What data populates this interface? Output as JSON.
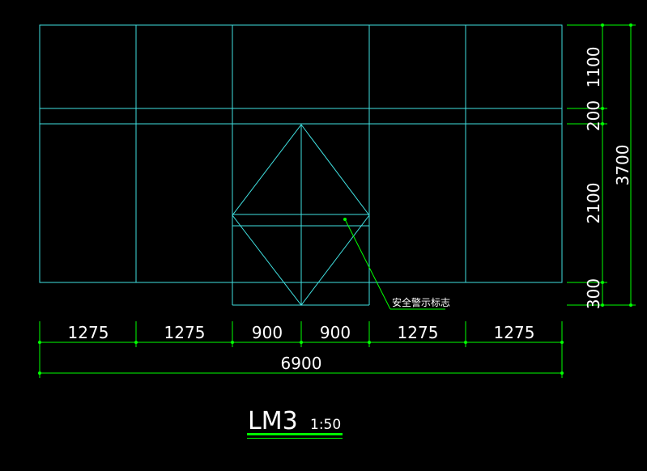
{
  "colors": {
    "background": "#000000",
    "geometry": "#40e0e0",
    "dimension": "#00ff00",
    "text": "#ffffff"
  },
  "dimensions": {
    "horizontal_segments": [
      "1275",
      "1275",
      "900",
      "900",
      "1275",
      "1275"
    ],
    "horizontal_total": "6900",
    "vertical_segments": [
      "1100",
      "200",
      "2100",
      "300"
    ],
    "vertical_total": "3700"
  },
  "annotation": {
    "label": "安全警示标志"
  },
  "title": {
    "name": "LM3",
    "scale": "1:50"
  }
}
